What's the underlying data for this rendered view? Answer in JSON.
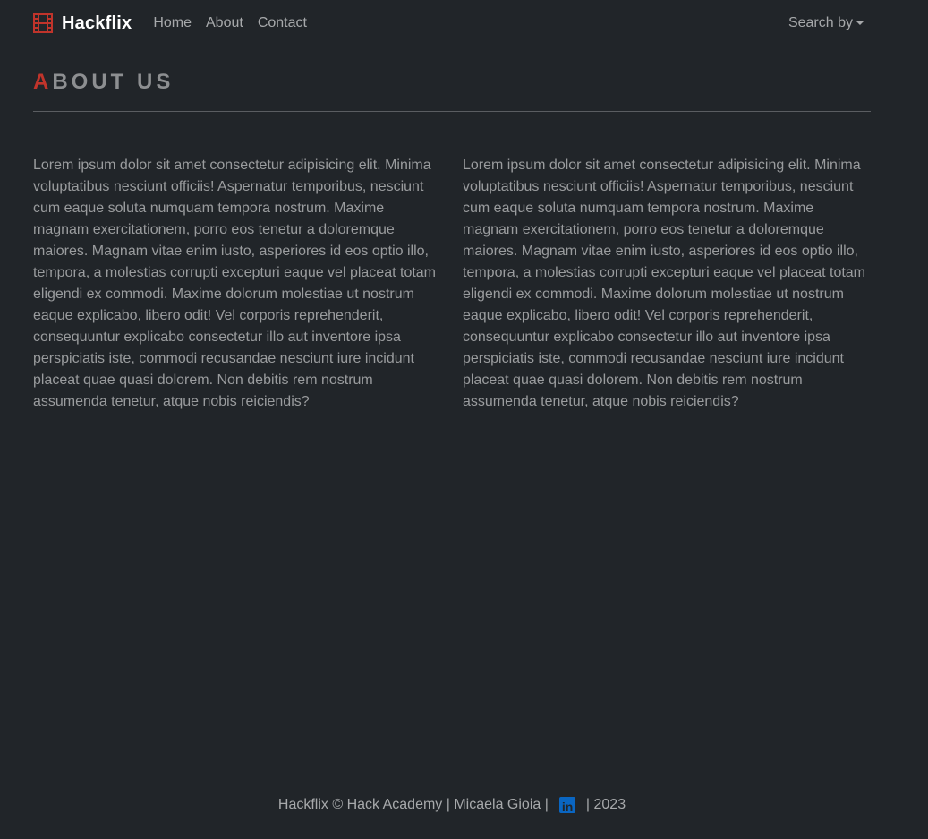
{
  "navbar": {
    "brand": "Hackflix",
    "brand_icon": "film-icon",
    "links": [
      "Home",
      "About",
      "Contact"
    ],
    "search_dropdown": "Search by"
  },
  "heading": {
    "first_letter": "A",
    "rest": "BOUT US"
  },
  "columns": {
    "left": "Lorem ipsum dolor sit amet consectetur adipisicing elit. Minima voluptatibus nesciunt officiis! Aspernatur temporibus, nesciunt cum eaque soluta numquam tempora nostrum. Maxime magnam exercitationem, porro eos tenetur a doloremque maiores. Magnam vitae enim iusto, asperiores id eos optio illo, tempora, a molestias corrupti excepturi eaque vel placeat totam eligendi ex commodi. Maxime dolorum molestiae ut nostrum eaque explicabo, libero odit! Vel corporis reprehenderit, consequuntur explicabo consectetur illo aut inventore ipsa perspiciatis iste, commodi recusandae nesciunt iure incidunt placeat quae quasi dolorem. Non debitis rem nostrum assumenda tenetur, atque nobis reiciendis?",
    "right": "Lorem ipsum dolor sit amet consectetur adipisicing elit. Minima voluptatibus nesciunt officiis! Aspernatur temporibus, nesciunt cum eaque soluta numquam tempora nostrum. Maxime magnam exercitationem, porro eos tenetur a doloremque maiores. Magnam vitae enim iusto, asperiores id eos optio illo, tempora, a molestias corrupti excepturi eaque vel placeat totam eligendi ex commodi. Maxime dolorum molestiae ut nostrum eaque explicabo, libero odit! Vel corporis reprehenderit, consequuntur explicabo consectetur illo aut inventore ipsa perspiciatis iste, commodi recusandae nesciunt iure incidunt placeat quae quasi dolorem. Non debitis rem nostrum assumenda tenetur, atque nobis reiciendis?"
  },
  "footer": {
    "text_before": "Hackflix © Hack Academy | Micaela Gioia |",
    "icon": "linkedin-icon",
    "text_after": "| 2023"
  },
  "colors": {
    "background": "#212529",
    "accent": "#c0342b",
    "linkedin": "#0a66c2"
  }
}
